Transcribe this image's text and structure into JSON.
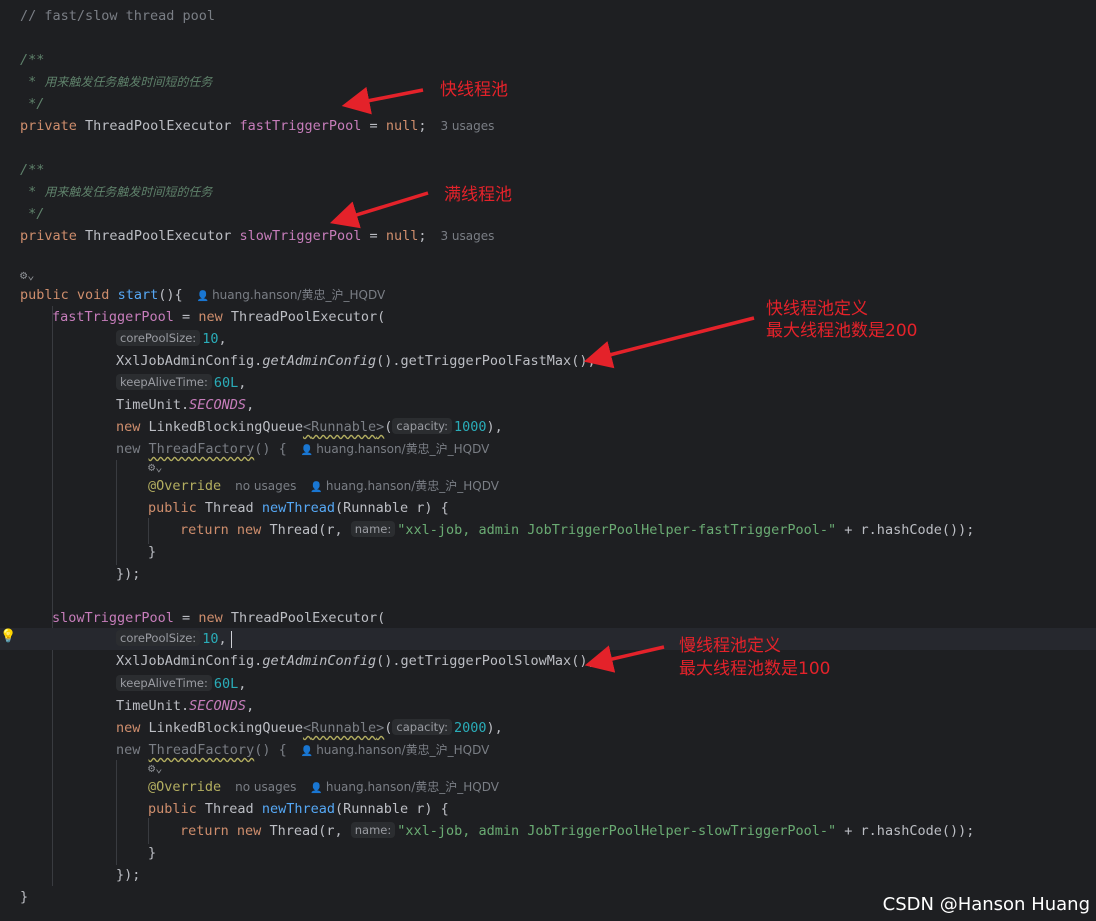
{
  "code": {
    "pool_comment": "// fast/slow thread pool",
    "doc_open": "/**",
    "doc_star": " * ",
    "doc_close": " */",
    "doc_text_fast": "用来触发任务触发时间短的任务",
    "doc_text_slow": "用来触发任务触发时间短的任务",
    "kw_private": "private",
    "type_executor": "ThreadPoolExecutor",
    "field_fast": "fastTriggerPool",
    "field_slow": "slowTriggerPool",
    "assign": " = ",
    "kw_null": "null",
    "semi": ";",
    "usages": "3 usages",
    "kw_public": "public",
    "kw_void": "void",
    "method_start": "start",
    "start_parens": "(){",
    "author": "huang.hanson/黄忠_沪_HQDV",
    "kw_new": "new",
    "paren_open": "(",
    "hint_core": "corePoolSize:",
    "val_core": "10",
    "comma": ",",
    "config_class": "XxlJobAdminConfig.",
    "get_admin_config": "getAdminConfig",
    "empty_parens": "()",
    "get_fast_max": ".getTriggerPoolFastMax",
    "get_slow_max": ".getTriggerPoolSlowMax",
    "close_paren_comma": "(),",
    "hint_keep_alive": "keepAliveTime:",
    "val_keep_alive": "60L",
    "time_unit": "TimeUnit.",
    "seconds": "SECONDS",
    "queue_class": "LinkedBlockingQueue",
    "generic_open": "<",
    "runnable": "Runnable",
    "generic_close": ">",
    "hint_capacity": "capacity:",
    "val_capacity_fast": "1000",
    "val_capacity_slow": "2000",
    "close_comma": "),",
    "thread_factory": "ThreadFactory",
    "brace_open": " {",
    "override": "@Override",
    "no_usages": "no usages",
    "type_thread": "Thread",
    "new_thread": "newThread",
    "param_runnable": "Runnable r",
    "kw_return": "return",
    "r_comma": "r, ",
    "hint_name": "name:",
    "str_fast": "\"xxl-job, admin JobTriggerPoolHelper-fastTriggerPool-\"",
    "str_slow": "\"xxl-job, admin JobTriggerPoolHelper-slowTriggerPool-\"",
    "plus_hash": " + r.hashCode",
    "end_call": "());",
    "brace_close": "}",
    "close_factory": "});"
  },
  "annotations": {
    "fast_pool": "快线程池",
    "slow_pool": "满线程池",
    "fast_def_line1": "快线程池定义",
    "fast_def_line2": "最大线程池数是200",
    "slow_def_line1": "慢线程池定义",
    "slow_def_line2": "最大线程池数是100"
  },
  "watermark": "CSDN @Hanson Huang",
  "icons": {
    "ai_assistant": "ai-assistant-icon",
    "user": "user-icon",
    "bulb": "lightbulb-icon"
  },
  "colors": {
    "background": "#1e1f22",
    "keyword": "#cf8e6d",
    "field": "#c77dbb",
    "number": "#2aacb8",
    "string": "#6aab73",
    "method": "#56a8f5",
    "annotation_red": "#e4222a"
  }
}
